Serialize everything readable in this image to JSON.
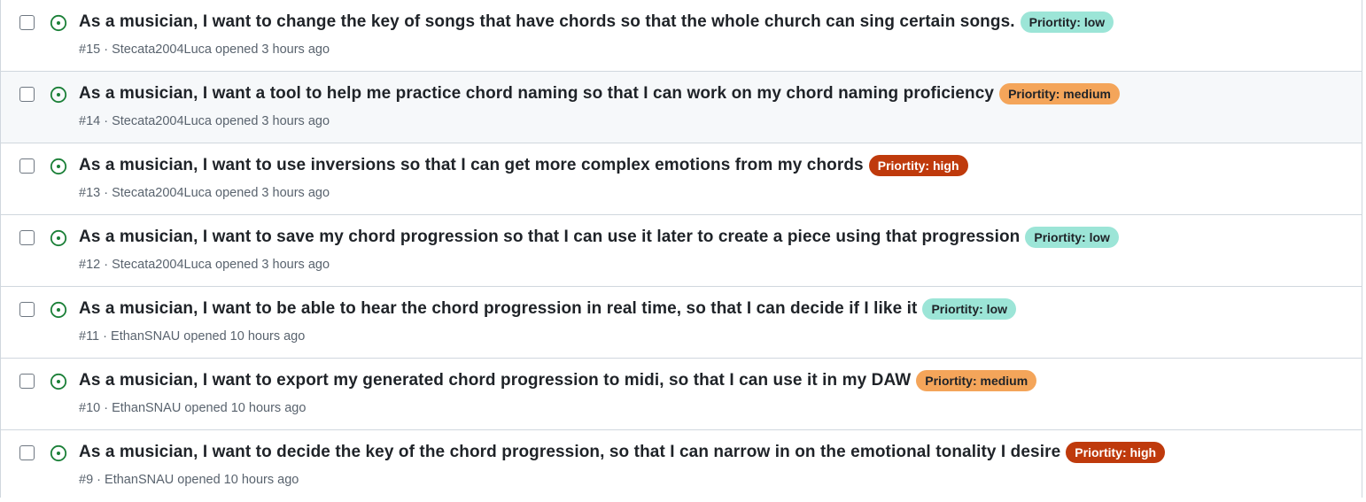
{
  "issues": [
    {
      "title": "As a musician, I want to change the key of songs that have chords so that the whole church can sing certain songs.",
      "label": "Priortity: low",
      "priority": "low",
      "number": "#15",
      "author": "Stecata2004Luca",
      "opened": "opened 3 hours ago"
    },
    {
      "title": "As a musician, I want a tool to help me practice chord naming so that I can work on my chord naming proficiency",
      "label": "Priortity: medium",
      "priority": "medium",
      "number": "#14",
      "author": "Stecata2004Luca",
      "opened": "opened 3 hours ago"
    },
    {
      "title": "As a musician, I want to use inversions so that I can get more complex emotions from my chords",
      "label": "Priortity: high",
      "priority": "high",
      "number": "#13",
      "author": "Stecata2004Luca",
      "opened": "opened 3 hours ago"
    },
    {
      "title": "As a musician, I want to save my chord progression so that I can use it later to create a piece using that progression",
      "label": "Priortity: low",
      "priority": "low",
      "number": "#12",
      "author": "Stecata2004Luca",
      "opened": "opened 3 hours ago"
    },
    {
      "title": "As a musician, I want to be able to hear the chord progression in real time, so that I can decide if I like it",
      "label": "Priortity: low",
      "priority": "low",
      "number": "#11",
      "author": "EthanSNAU",
      "opened": "opened 10 hours ago"
    },
    {
      "title": "As a musician, I want to export my generated chord progression to midi, so that I can use it in my DAW",
      "label": "Priortity: medium",
      "priority": "medium",
      "number": "#10",
      "author": "EthanSNAU",
      "opened": "opened 10 hours ago"
    },
    {
      "title": "As a musician, I want to decide the key of the chord progression, so that I can narrow in on the emotional tonality I desire",
      "label": "Priortity: high",
      "priority": "high",
      "number": "#9",
      "author": "EthanSNAU",
      "opened": "opened 10 hours ago"
    }
  ],
  "meta_separator": "·",
  "colors": {
    "open_icon": "#1a7f37",
    "low": "#9ce5d7",
    "medium": "#f4a55a",
    "high": "#bf3a0c"
  },
  "icons": {
    "status": "issue-opened-icon"
  }
}
